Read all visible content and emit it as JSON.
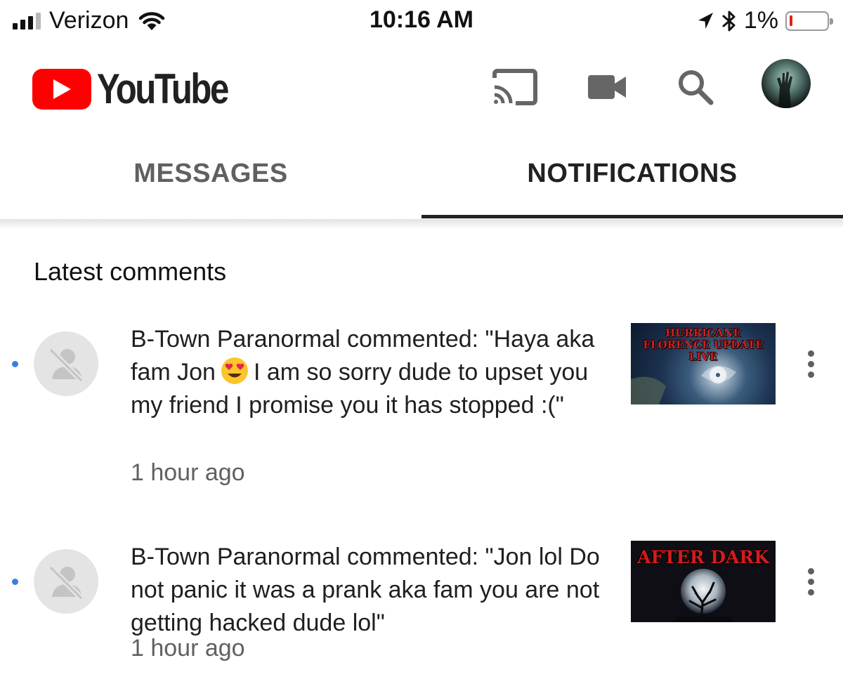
{
  "status_bar": {
    "carrier": "Verizon",
    "time": "10:16 AM",
    "battery_percent": "1%",
    "battery_level": 0.01,
    "signal_bars": 3,
    "signal_max": 4,
    "icons": [
      "signal-icon",
      "wifi-icon",
      "location-arrow-icon",
      "bluetooth-icon",
      "battery-icon"
    ]
  },
  "header": {
    "logo_text": "YouTube",
    "brand_color": "#FF0000",
    "actions": [
      "cast-icon",
      "video-camera-icon",
      "search-icon",
      "account-avatar"
    ]
  },
  "tabs": [
    {
      "label": "MESSAGES",
      "selected": false
    },
    {
      "label": "NOTIFICATIONS",
      "selected": true
    }
  ],
  "section": {
    "title": "Latest comments"
  },
  "notifications": [
    {
      "text_before_emoji": "B-Town Paranormal commented: \"Haya aka fam Jon",
      "emoji": "heart-eyes-emoji",
      "text_after_emoji": "I am so sorry dude to upset you my friend I promise you it has stopped :(\"",
      "time": "1 hour ago",
      "thumbnail_title": "HURRICANE FLORENCE UPDATE LIVE",
      "unread": true
    },
    {
      "text": "B-Town Paranormal commented: \"Jon lol Do not panic it was a prank aka fam you are not getting hacked dude lol\"",
      "time": "1 hour ago",
      "thumbnail_title": "AFTER DARK",
      "unread": true
    }
  ],
  "colors": {
    "unread_dot": "#3D7DDB",
    "tab_indicator": "#212121",
    "thumbnail_title": "#D41C1C"
  }
}
